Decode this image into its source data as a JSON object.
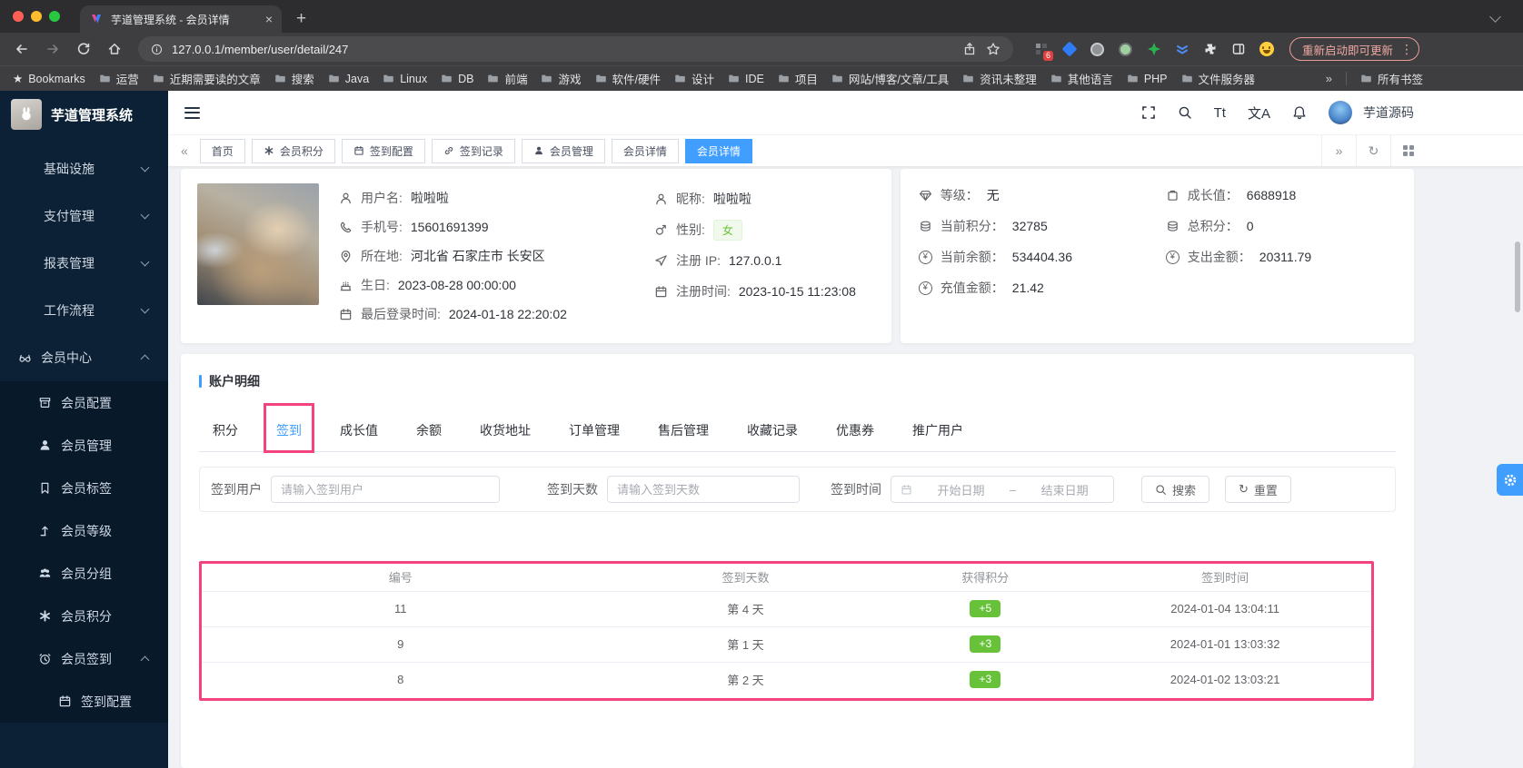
{
  "browser": {
    "tab_title": "芋道管理系统 - 会员详情",
    "url": "127.0.0.1/member/user/detail/247",
    "update_button": "重新启动即可更新",
    "extension_badge": "6",
    "bookmarks_label": "Bookmarks",
    "bookmarks": [
      "运营",
      "近期需要读的文章",
      "搜索",
      "Java",
      "Linux",
      "DB",
      "前端",
      "游戏",
      "软件/硬件",
      "设计",
      "IDE",
      "项目",
      "网站/博客/文章/工具",
      "资讯未整理",
      "其他语言",
      "PHP",
      "文件服务器"
    ],
    "all_bookmarks": "所有书签"
  },
  "icons": {
    "collapse": "«",
    "expand": "»",
    "new_tab": "+",
    "close": "×",
    "menu_dots": "⋮",
    "font_size": "Tt",
    "locale": "文A",
    "refresh": "↻",
    "yen": "¥",
    "star": "★"
  },
  "sidebar": {
    "app_title": "芋道管理系统",
    "groups": [
      {
        "label": "基础设施"
      },
      {
        "label": "支付管理"
      },
      {
        "label": "报表管理"
      },
      {
        "label": "工作流程"
      }
    ],
    "member_center": {
      "label": "会员中心",
      "icon": "glasses-icon"
    },
    "items": [
      {
        "label": "会员配置",
        "icon": "archive-icon"
      },
      {
        "label": "会员管理",
        "icon": "user-icon"
      },
      {
        "label": "会员标签",
        "icon": "bookmark-icon"
      },
      {
        "label": "会员等级",
        "icon": "level-up-icon"
      },
      {
        "label": "会员分组",
        "icon": "group-icon"
      },
      {
        "label": "会员积分",
        "icon": "asterisk-icon"
      },
      {
        "label": "会员签到",
        "icon": "alarm-clock-icon",
        "expanded": true
      }
    ],
    "sub_item": {
      "label": "签到配置",
      "icon": "calendar-icon"
    }
  },
  "header": {
    "username": "芋道源码"
  },
  "tags": {
    "items": [
      {
        "label": "首页"
      },
      {
        "label": "会员积分",
        "icon": "asterisk-icon"
      },
      {
        "label": "签到配置",
        "icon": "calendar-icon"
      },
      {
        "label": "签到记录",
        "icon": "link-icon"
      },
      {
        "label": "会员管理",
        "icon": "user-icon"
      },
      {
        "label": "会员详情"
      },
      {
        "label": "会员详情",
        "active": true
      }
    ]
  },
  "profile": {
    "fields_left": [
      {
        "label": "用户名:",
        "value": "啦啦啦",
        "icon": "user-icon"
      },
      {
        "label": "手机号:",
        "value": "15601691399",
        "icon": "phone-icon"
      },
      {
        "label": "所在地:",
        "value": "河北省 石家庄市 长安区",
        "icon": "location-icon"
      },
      {
        "label": "生日:",
        "value": "2023-08-28 00:00:00",
        "icon": "cake-icon"
      },
      {
        "label": "最后登录时间:",
        "value": "2024-01-18 22:20:02",
        "icon": "calendar-icon"
      }
    ],
    "fields_mid": [
      {
        "label": "昵称:",
        "value": "啦啦啦",
        "icon": "user-icon"
      },
      {
        "label": "性别:",
        "value": "女",
        "icon": "gender-icon",
        "tag": true
      },
      {
        "label": "注册 IP:",
        "value": "127.0.0.1",
        "icon": "send-icon"
      },
      {
        "label": "注册时间:",
        "value": "2023-10-15 11:23:08",
        "icon": "calendar-icon"
      }
    ],
    "stats_left": [
      {
        "label": "等级：",
        "value": "无",
        "icon": "diamond-icon"
      },
      {
        "label": "当前积分：",
        "value": "32785",
        "icon": "coins-icon"
      },
      {
        "label": "当前余额：",
        "value": "534404.36",
        "icon": "yen-circle-icon"
      },
      {
        "label": "充值金额：",
        "value": "21.42",
        "icon": "yen-circle-icon"
      }
    ],
    "stats_right": [
      {
        "label": "成长值：",
        "value": "6688918",
        "icon": "battery-icon"
      },
      {
        "label": "总积分：",
        "value": "0",
        "icon": "coins-icon"
      },
      {
        "label": "支出金额：",
        "value": "20311.79",
        "icon": "yen-circle-icon"
      }
    ]
  },
  "account": {
    "title": "账户明细",
    "tabs": [
      {
        "label": "积分"
      },
      {
        "label": "签到",
        "active": true
      },
      {
        "label": "成长值"
      },
      {
        "label": "余额"
      },
      {
        "label": "收货地址"
      },
      {
        "label": "订单管理"
      },
      {
        "label": "售后管理"
      },
      {
        "label": "收藏记录"
      },
      {
        "label": "优惠券"
      },
      {
        "label": "推广用户"
      }
    ],
    "filters": {
      "user_label": "签到用户",
      "user_placeholder": "请输入签到用户",
      "days_label": "签到天数",
      "days_placeholder": "请输入签到天数",
      "time_label": "签到时间",
      "start_placeholder": "开始日期",
      "range_separator": "–",
      "end_placeholder": "结束日期",
      "search_label": "搜索",
      "reset_label": "重置"
    },
    "table": {
      "columns": [
        "编号",
        "签到天数",
        "获得积分",
        "签到时间"
      ],
      "rows": [
        {
          "id": "11",
          "day": "第 4 天",
          "points": "+5",
          "time": "2024-01-04 13:04:11"
        },
        {
          "id": "9",
          "day": "第 1 天",
          "points": "+3",
          "time": "2024-01-01 13:03:32"
        },
        {
          "id": "8",
          "day": "第 2 天",
          "points": "+3",
          "time": "2024-01-02 13:03:21"
        }
      ]
    }
  },
  "colors": {
    "accent": "#409eff",
    "success": "#67c23a",
    "annotation": "#f2437f",
    "sidebar_bg": "#0c2135"
  }
}
